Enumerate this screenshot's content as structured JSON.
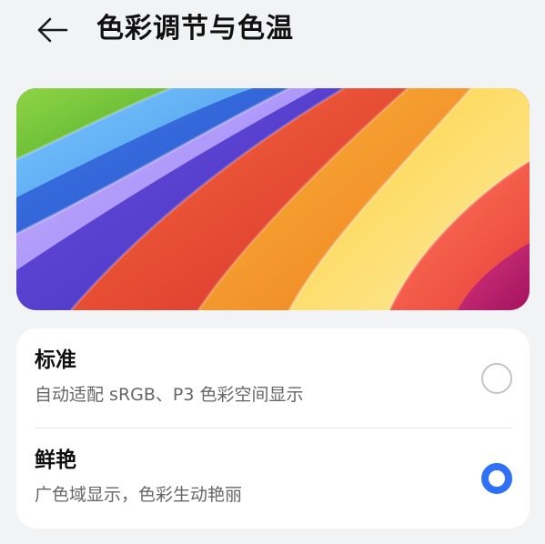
{
  "header": {
    "title": "色彩调节与色温",
    "back_icon": "arrow-left-icon"
  },
  "banner": {
    "image": "rainbow-wallpaper",
    "colors": [
      "#78c83a",
      "#5aa8ee",
      "#2f5fd8",
      "#b598ff",
      "#5a3bd0",
      "#e84533",
      "#f59c28",
      "#ffe27a",
      "#f0473c",
      "#c01a75"
    ]
  },
  "options": [
    {
      "label": "标准",
      "description": "自动适配 sRGB、P3 色彩空间显示",
      "selected": false
    },
    {
      "label": "鲜艳",
      "description": "广色域显示，色彩生动艳丽",
      "selected": true
    }
  ],
  "accent_color": "#2f71f6"
}
